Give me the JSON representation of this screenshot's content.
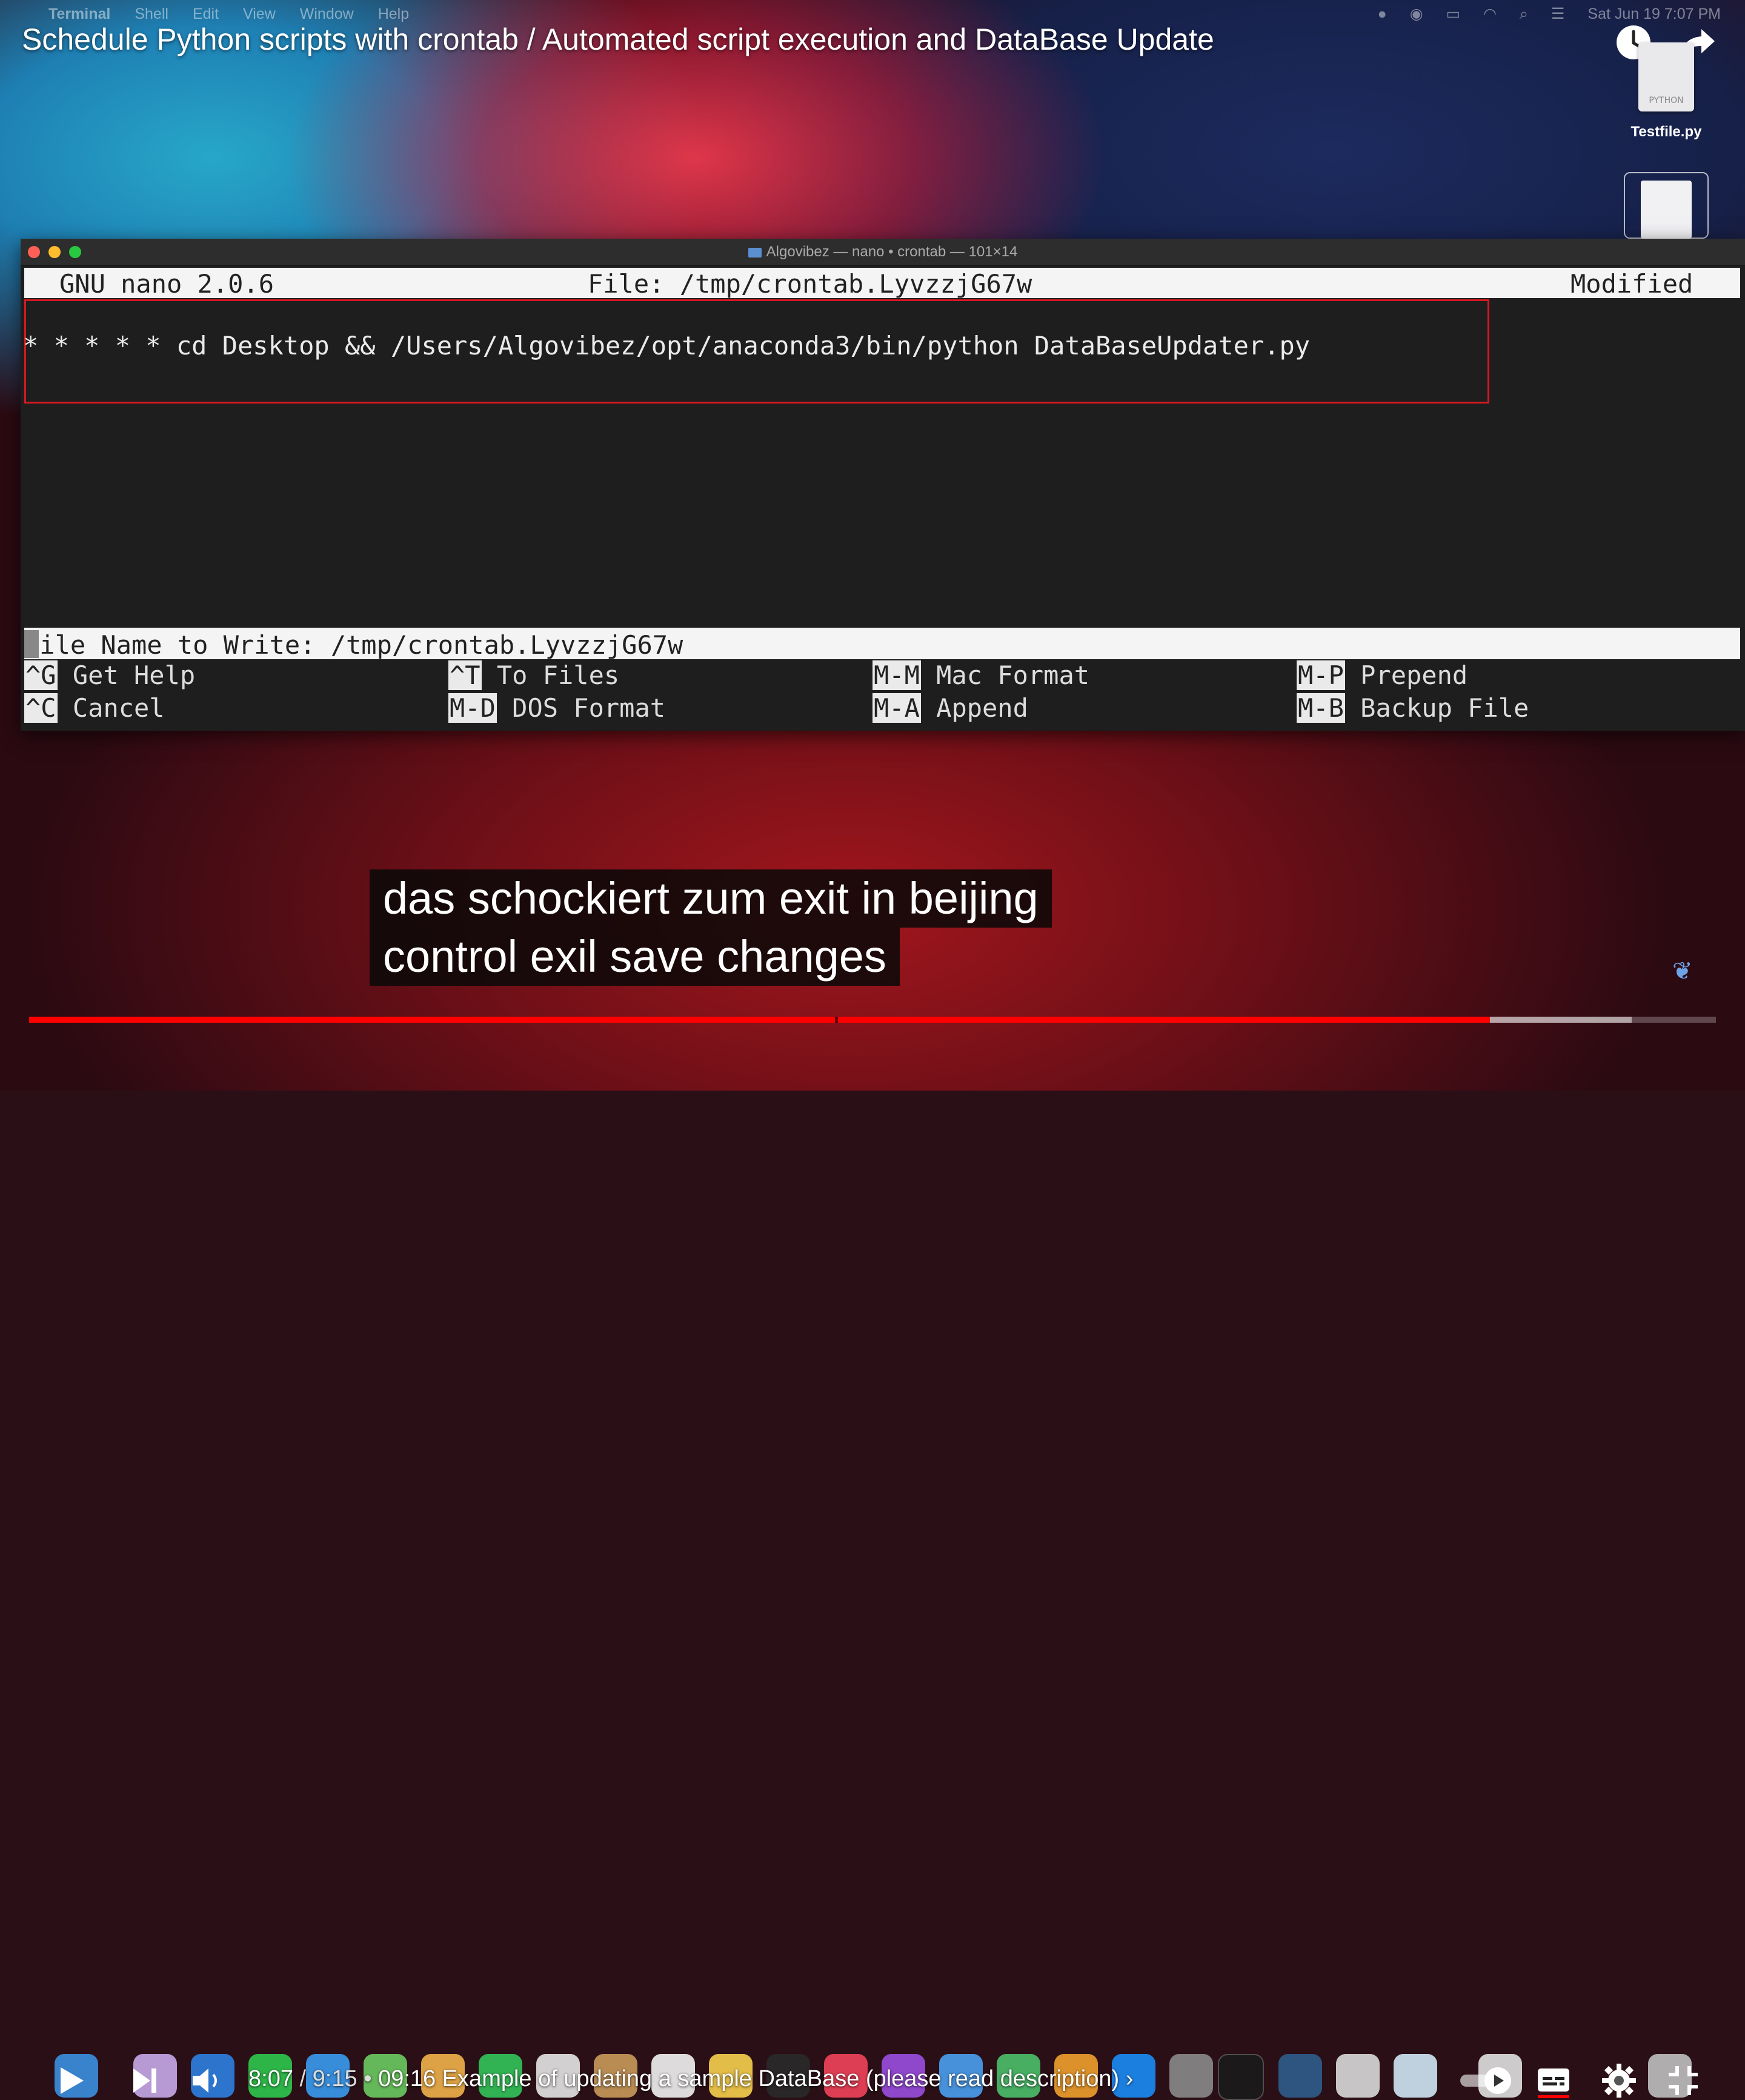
{
  "menubar": {
    "app_menu": "Terminal",
    "items": [
      "Shell",
      "Edit",
      "View",
      "Window",
      "Help"
    ],
    "datetime": "Sat Jun 19  7:07 PM"
  },
  "video": {
    "title": "Schedule Python scripts with crontab / Automated script execution and DataBase Update",
    "subtitle_lines": [
      "das schockiert zum exit in beijing",
      "control exil save changes"
    ],
    "time_current": "8:07",
    "time_total": "9:15",
    "chapter": "09:16 Example of updating a sample DataBase (please read description)",
    "progress_fraction": 0.866,
    "buffer_fraction": 0.95
  },
  "desktop": {
    "file1_name": "Testfile.py",
    "file1_badge": "PYTHON"
  },
  "terminal": {
    "window_title": "Algovibez — nano • crontab — 101×14",
    "nano_version": "GNU nano 2.0.6",
    "file_label": "File: /tmp/crontab.LyvzzjG67w",
    "status": "Modified",
    "cron_line": "* * * * * cd Desktop && /Users/Algovibez/opt/anaconda3/bin/python DataBaseUpdater.py",
    "prompt": "File Name to Write: /tmp/crontab.LyvzzjG67w",
    "shortcuts": [
      {
        "key": "^G",
        "label": "Get Help"
      },
      {
        "key": "^T",
        "label": "To Files"
      },
      {
        "key": "M-M",
        "label": "Mac Format"
      },
      {
        "key": "M-P",
        "label": "Prepend"
      },
      {
        "key": "^C",
        "label": "Cancel"
      },
      {
        "key": "M-D",
        "label": "DOS Format"
      },
      {
        "key": "M-A",
        "label": "Append"
      },
      {
        "key": "M-B",
        "label": "Backup File"
      }
    ]
  },
  "colors": {
    "accent_red": "#ff0000",
    "highlight_box": "#d71920",
    "terminal_bg": "#1e1e1e"
  },
  "icons": {
    "watch_later": "clock-icon",
    "share": "share-arrow-icon",
    "play": "play-icon",
    "next": "next-icon",
    "volume": "volume-icon",
    "autoplay": "autoplay-toggle-icon",
    "captions": "captions-icon",
    "settings": "gear-icon",
    "exit_fullscreen": "exit-fullscreen-icon"
  }
}
